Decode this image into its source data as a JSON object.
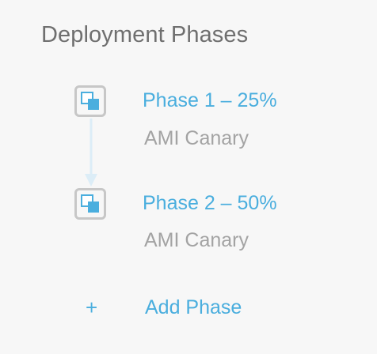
{
  "panel": {
    "title": "Deployment Phases"
  },
  "phases": [
    {
      "name": "Phase 1 – 25%",
      "subtitle": "AMI Canary",
      "icon": "phase-copy-icon"
    },
    {
      "name": "Phase 2 – 50%",
      "subtitle": "AMI Canary",
      "icon": "phase-copy-icon"
    }
  ],
  "add_phase": {
    "icon": "plus-icon",
    "symbol": "+",
    "label": "Add Phase"
  },
  "colors": {
    "accent": "#4aaede",
    "title": "#6f6f6f",
    "subtitle": "#a3a3a3",
    "icon_border": "#c7c7c7",
    "connector": "#dcedf7",
    "background": "#f7f7f7"
  }
}
